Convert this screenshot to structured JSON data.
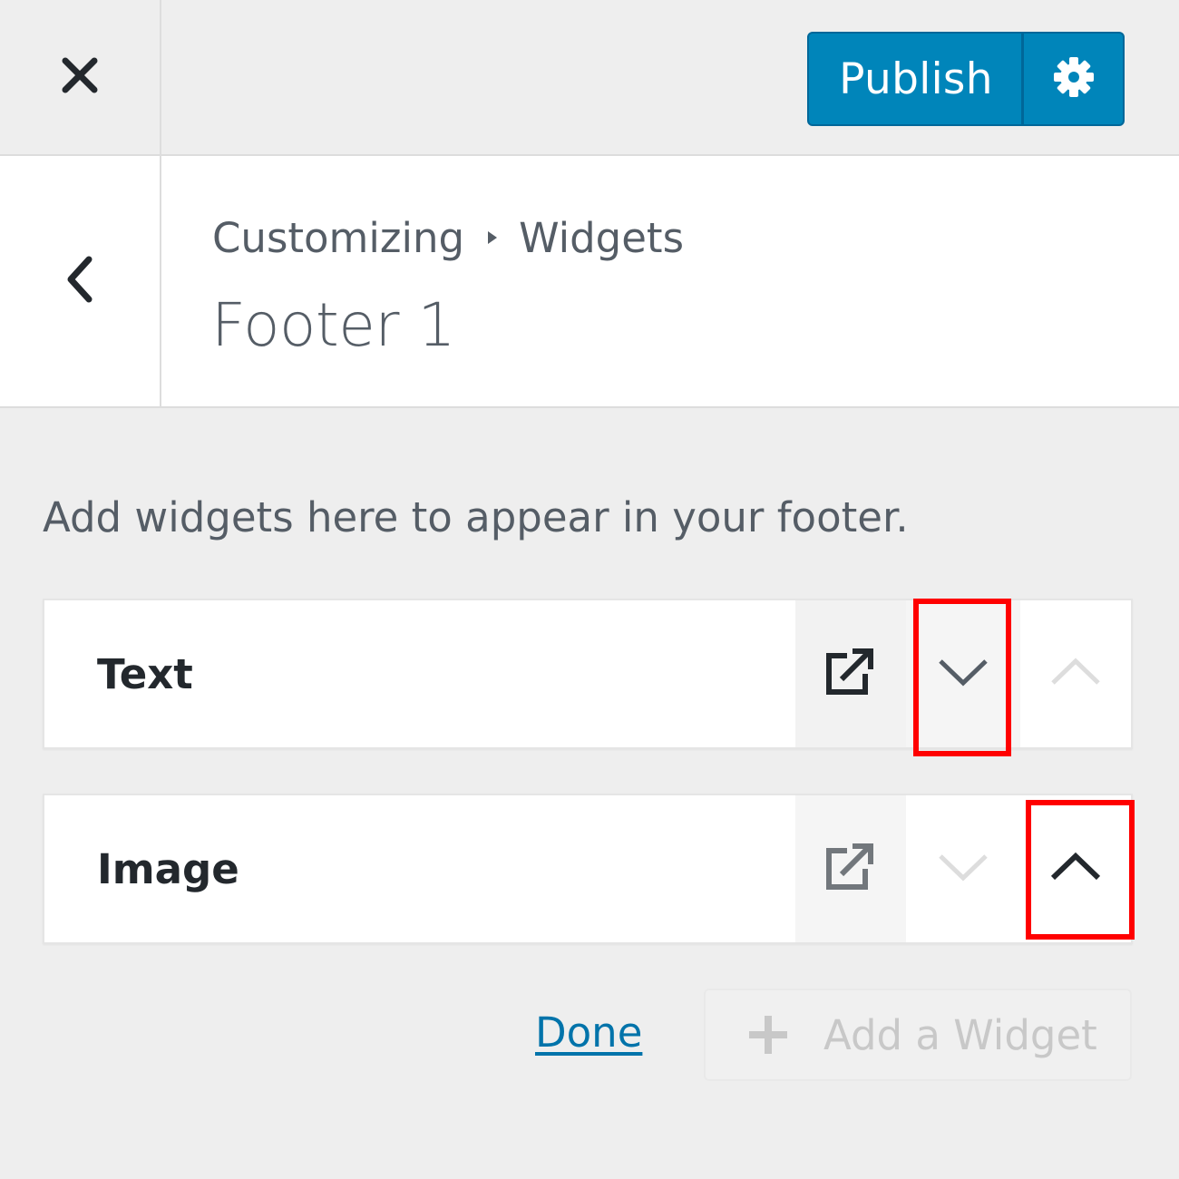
{
  "topbar": {
    "close_icon": "close-icon",
    "publish_label": "Publish",
    "settings_icon": "gear-icon",
    "accent_color": "#0085ba"
  },
  "header": {
    "back_icon": "chevron-left-icon",
    "breadcrumb": {
      "root": "Customizing",
      "separator_icon": "caret-right-icon",
      "section": "Widgets"
    },
    "title": "Footer 1"
  },
  "main": {
    "description": "Add widgets here to appear in your footer.",
    "widgets": [
      {
        "title": "Text",
        "edit_icon": "external-link-icon",
        "move_down_icon": "chevron-down-icon",
        "move_up_icon": "chevron-up-icon",
        "move_down_enabled": true,
        "move_up_enabled": false
      },
      {
        "title": "Image",
        "edit_icon": "external-link-icon",
        "move_down_icon": "chevron-down-icon",
        "move_up_icon": "chevron-up-icon",
        "move_down_enabled": false,
        "move_up_enabled": true
      }
    ],
    "highlight_color": "#ff0000"
  },
  "footer": {
    "done_label": "Done",
    "add_widget_label": "Add a Widget",
    "add_icon": "plus-icon"
  }
}
